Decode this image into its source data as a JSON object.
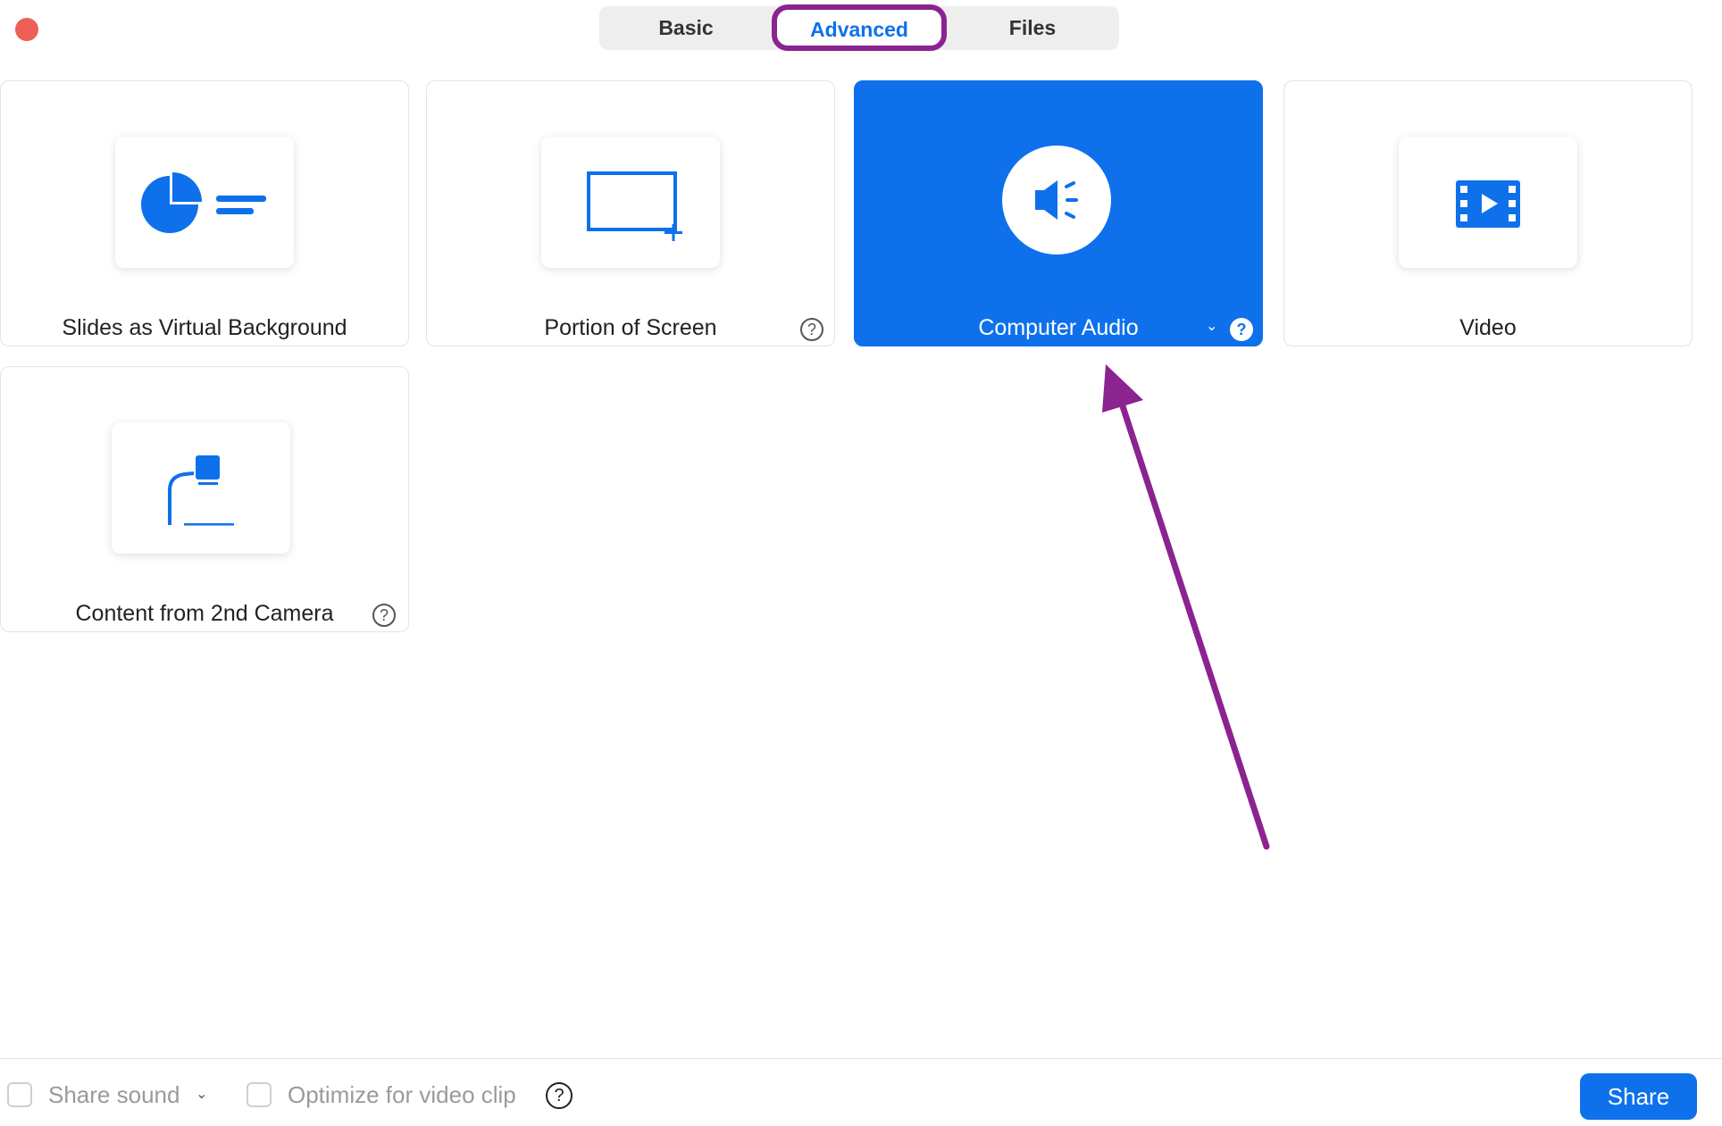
{
  "window": {
    "close_button": "close-dot"
  },
  "tabs": [
    {
      "label": "Basic",
      "active": false
    },
    {
      "label": "Advanced",
      "active": true
    },
    {
      "label": "Files",
      "active": false
    }
  ],
  "cards": [
    {
      "label": "Slides as Virtual Background",
      "icon": "slides-chart-icon",
      "selected": false,
      "help": false
    },
    {
      "label": "Portion of Screen",
      "icon": "screen-portion-icon",
      "selected": false,
      "help": true
    },
    {
      "label": "Computer Audio",
      "icon": "speaker-icon",
      "selected": true,
      "help": true,
      "dropdown": true
    },
    {
      "label": "Video",
      "icon": "film-icon",
      "selected": false,
      "help": false
    },
    {
      "label": "Content from 2nd Camera",
      "icon": "document-camera-icon",
      "selected": false,
      "help": true
    }
  ],
  "help_glyph": "?",
  "chevron_glyph": "⌄",
  "footer": {
    "share_sound_label": "Share sound",
    "optimize_label": "Optimize for video clip",
    "share_button": "Share"
  },
  "colors": {
    "accent": "#0e71eb",
    "annotation": "#8b2391",
    "close": "#ed5f57"
  }
}
